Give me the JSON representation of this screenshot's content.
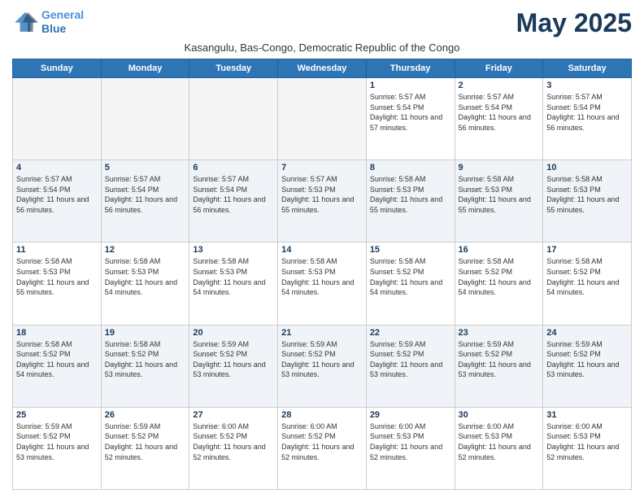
{
  "logo": {
    "line1": "General",
    "line2": "Blue"
  },
  "title": "May 2025",
  "subtitle": "Kasangulu, Bas-Congo, Democratic Republic of the Congo",
  "days_of_week": [
    "Sunday",
    "Monday",
    "Tuesday",
    "Wednesday",
    "Thursday",
    "Friday",
    "Saturday"
  ],
  "weeks": [
    [
      {
        "day": "",
        "empty": true
      },
      {
        "day": "",
        "empty": true
      },
      {
        "day": "",
        "empty": true
      },
      {
        "day": "",
        "empty": true
      },
      {
        "day": "1",
        "sunrise": "5:57 AM",
        "sunset": "5:54 PM",
        "daylight": "11 hours and 57 minutes."
      },
      {
        "day": "2",
        "sunrise": "5:57 AM",
        "sunset": "5:54 PM",
        "daylight": "11 hours and 56 minutes."
      },
      {
        "day": "3",
        "sunrise": "5:57 AM",
        "sunset": "5:54 PM",
        "daylight": "11 hours and 56 minutes."
      }
    ],
    [
      {
        "day": "4",
        "sunrise": "5:57 AM",
        "sunset": "5:54 PM",
        "daylight": "11 hours and 56 minutes."
      },
      {
        "day": "5",
        "sunrise": "5:57 AM",
        "sunset": "5:54 PM",
        "daylight": "11 hours and 56 minutes."
      },
      {
        "day": "6",
        "sunrise": "5:57 AM",
        "sunset": "5:54 PM",
        "daylight": "11 hours and 56 minutes."
      },
      {
        "day": "7",
        "sunrise": "5:57 AM",
        "sunset": "5:53 PM",
        "daylight": "11 hours and 55 minutes."
      },
      {
        "day": "8",
        "sunrise": "5:58 AM",
        "sunset": "5:53 PM",
        "daylight": "11 hours and 55 minutes."
      },
      {
        "day": "9",
        "sunrise": "5:58 AM",
        "sunset": "5:53 PM",
        "daylight": "11 hours and 55 minutes."
      },
      {
        "day": "10",
        "sunrise": "5:58 AM",
        "sunset": "5:53 PM",
        "daylight": "11 hours and 55 minutes."
      }
    ],
    [
      {
        "day": "11",
        "sunrise": "5:58 AM",
        "sunset": "5:53 PM",
        "daylight": "11 hours and 55 minutes."
      },
      {
        "day": "12",
        "sunrise": "5:58 AM",
        "sunset": "5:53 PM",
        "daylight": "11 hours and 54 minutes."
      },
      {
        "day": "13",
        "sunrise": "5:58 AM",
        "sunset": "5:53 PM",
        "daylight": "11 hours and 54 minutes."
      },
      {
        "day": "14",
        "sunrise": "5:58 AM",
        "sunset": "5:53 PM",
        "daylight": "11 hours and 54 minutes."
      },
      {
        "day": "15",
        "sunrise": "5:58 AM",
        "sunset": "5:52 PM",
        "daylight": "11 hours and 54 minutes."
      },
      {
        "day": "16",
        "sunrise": "5:58 AM",
        "sunset": "5:52 PM",
        "daylight": "11 hours and 54 minutes."
      },
      {
        "day": "17",
        "sunrise": "5:58 AM",
        "sunset": "5:52 PM",
        "daylight": "11 hours and 54 minutes."
      }
    ],
    [
      {
        "day": "18",
        "sunrise": "5:58 AM",
        "sunset": "5:52 PM",
        "daylight": "11 hours and 54 minutes."
      },
      {
        "day": "19",
        "sunrise": "5:58 AM",
        "sunset": "5:52 PM",
        "daylight": "11 hours and 53 minutes."
      },
      {
        "day": "20",
        "sunrise": "5:59 AM",
        "sunset": "5:52 PM",
        "daylight": "11 hours and 53 minutes."
      },
      {
        "day": "21",
        "sunrise": "5:59 AM",
        "sunset": "5:52 PM",
        "daylight": "11 hours and 53 minutes."
      },
      {
        "day": "22",
        "sunrise": "5:59 AM",
        "sunset": "5:52 PM",
        "daylight": "11 hours and 53 minutes."
      },
      {
        "day": "23",
        "sunrise": "5:59 AM",
        "sunset": "5:52 PM",
        "daylight": "11 hours and 53 minutes."
      },
      {
        "day": "24",
        "sunrise": "5:59 AM",
        "sunset": "5:52 PM",
        "daylight": "11 hours and 53 minutes."
      }
    ],
    [
      {
        "day": "25",
        "sunrise": "5:59 AM",
        "sunset": "5:52 PM",
        "daylight": "11 hours and 53 minutes."
      },
      {
        "day": "26",
        "sunrise": "5:59 AM",
        "sunset": "5:52 PM",
        "daylight": "11 hours and 52 minutes."
      },
      {
        "day": "27",
        "sunrise": "6:00 AM",
        "sunset": "5:52 PM",
        "daylight": "11 hours and 52 minutes."
      },
      {
        "day": "28",
        "sunrise": "6:00 AM",
        "sunset": "5:52 PM",
        "daylight": "11 hours and 52 minutes."
      },
      {
        "day": "29",
        "sunrise": "6:00 AM",
        "sunset": "5:53 PM",
        "daylight": "11 hours and 52 minutes."
      },
      {
        "day": "30",
        "sunrise": "6:00 AM",
        "sunset": "5:53 PM",
        "daylight": "11 hours and 52 minutes."
      },
      {
        "day": "31",
        "sunrise": "6:00 AM",
        "sunset": "5:53 PM",
        "daylight": "11 hours and 52 minutes."
      }
    ]
  ]
}
